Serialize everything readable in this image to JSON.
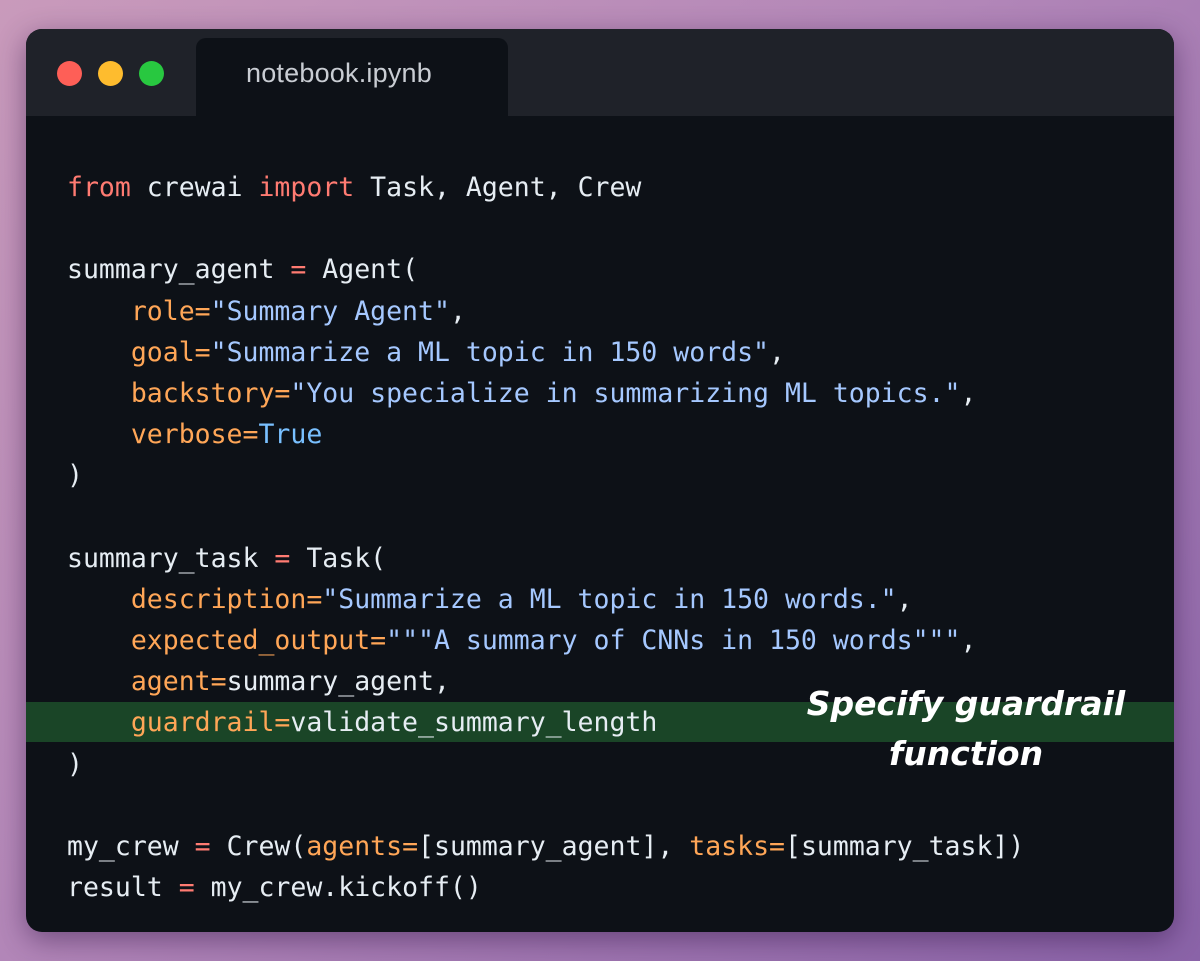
{
  "window": {
    "controls": [
      "close",
      "minimize",
      "maximize"
    ],
    "tab_title": "notebook.ipynb"
  },
  "code_lines": [
    [
      {
        "t": "from",
        "c": "kw"
      },
      {
        "t": " crewai ",
        "c": "plain"
      },
      {
        "t": "import",
        "c": "kw"
      },
      {
        "t": " Task, Agent, Crew",
        "c": "plain"
      }
    ],
    [],
    [
      {
        "t": "summary_agent ",
        "c": "plain"
      },
      {
        "t": "=",
        "c": "op"
      },
      {
        "t": " Agent(",
        "c": "plain"
      }
    ],
    [
      {
        "t": "    ",
        "c": "plain"
      },
      {
        "t": "role=",
        "c": "param"
      },
      {
        "t": "\"Summary Agent\"",
        "c": "str"
      },
      {
        "t": ",",
        "c": "plain"
      }
    ],
    [
      {
        "t": "    ",
        "c": "plain"
      },
      {
        "t": "goal=",
        "c": "param"
      },
      {
        "t": "\"Summarize a ML topic in 150 words\"",
        "c": "str"
      },
      {
        "t": ",",
        "c": "plain"
      }
    ],
    [
      {
        "t": "    ",
        "c": "plain"
      },
      {
        "t": "backstory=",
        "c": "param"
      },
      {
        "t": "\"You specialize in summarizing ML topics.\"",
        "c": "str"
      },
      {
        "t": ",",
        "c": "plain"
      }
    ],
    [
      {
        "t": "    ",
        "c": "plain"
      },
      {
        "t": "verbose=",
        "c": "param"
      },
      {
        "t": "True",
        "c": "const"
      }
    ],
    [
      {
        "t": ")",
        "c": "plain"
      }
    ],
    [],
    [
      {
        "t": "summary_task ",
        "c": "plain"
      },
      {
        "t": "=",
        "c": "op"
      },
      {
        "t": " Task(",
        "c": "plain"
      }
    ],
    [
      {
        "t": "    ",
        "c": "plain"
      },
      {
        "t": "description=",
        "c": "param"
      },
      {
        "t": "\"Summarize a ML topic in 150 words.\"",
        "c": "str"
      },
      {
        "t": ",",
        "c": "plain"
      }
    ],
    [
      {
        "t": "    ",
        "c": "plain"
      },
      {
        "t": "expected_output=",
        "c": "param"
      },
      {
        "t": "\"\"\"A summary of CNNs in 150 words\"\"\"",
        "c": "str"
      },
      {
        "t": ",",
        "c": "plain"
      }
    ],
    [
      {
        "t": "    ",
        "c": "plain"
      },
      {
        "t": "agent=",
        "c": "param"
      },
      {
        "t": "summary_agent,",
        "c": "plain"
      }
    ],
    [
      {
        "t": "    ",
        "c": "plain"
      },
      {
        "t": "guardrail=",
        "c": "param"
      },
      {
        "t": "validate_summary_length",
        "c": "plain"
      }
    ],
    [
      {
        "t": ")",
        "c": "plain"
      }
    ],
    [],
    [
      {
        "t": "my_crew ",
        "c": "plain"
      },
      {
        "t": "=",
        "c": "op"
      },
      {
        "t": " Crew(",
        "c": "plain"
      },
      {
        "t": "agents=",
        "c": "param"
      },
      {
        "t": "[summary_agent], ",
        "c": "plain"
      },
      {
        "t": "tasks=",
        "c": "param"
      },
      {
        "t": "[summary_task])",
        "c": "plain"
      }
    ],
    [
      {
        "t": "result ",
        "c": "plain"
      },
      {
        "t": "=",
        "c": "op"
      },
      {
        "t": " my_crew.kickoff()",
        "c": "plain"
      }
    ]
  ],
  "highlighted_line_number": 14,
  "annotation": {
    "line1": "Specify guardrail",
    "line2": "function"
  },
  "colors": {
    "background_gradient": [
      "#c99abb",
      "#8a63a8"
    ],
    "window_bg": "#0d1117",
    "titlebar_bg": "#1f2229",
    "highlight_bg": "#1a4527",
    "keyword": "#ff7b72",
    "parameter": "#ffa657",
    "string": "#a5c8ff",
    "constant": "#79c0ff",
    "plain_text": "#e6edf3"
  }
}
